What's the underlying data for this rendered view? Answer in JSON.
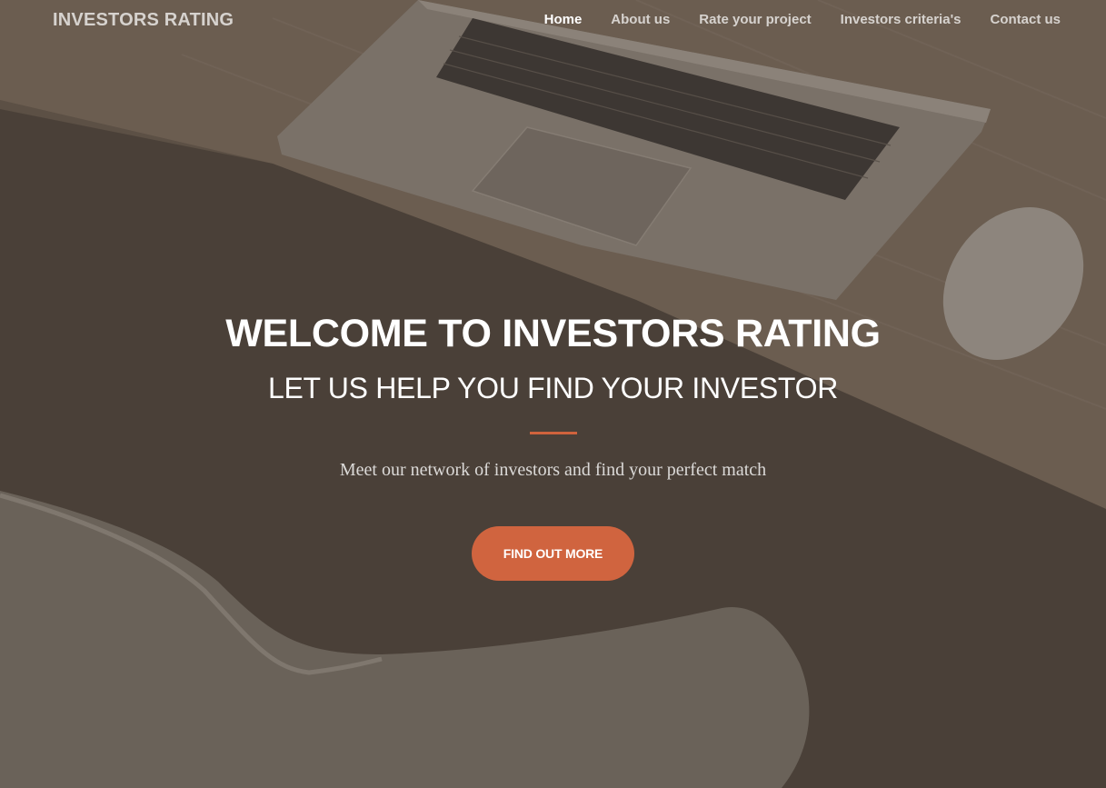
{
  "navbar": {
    "brand": "INVESTORS RATING",
    "items": [
      {
        "label": "Home",
        "active": true
      },
      {
        "label": "About us",
        "active": false
      },
      {
        "label": "Rate your project",
        "active": false
      },
      {
        "label": "Investors criteria's",
        "active": false
      },
      {
        "label": "Contact us",
        "active": false
      }
    ]
  },
  "hero": {
    "title": "WELCOME TO INVESTORS RATING",
    "subtitle": "LET US HELP YOU FIND YOUR INVESTOR",
    "lead": "Meet our network of investors and find your perfect match",
    "cta_label": "FIND OUT MORE",
    "background": "laptop-desk-photo"
  },
  "colors": {
    "accent": "#d0633d",
    "overlay": "#4a4038",
    "text": "#ffffff"
  }
}
